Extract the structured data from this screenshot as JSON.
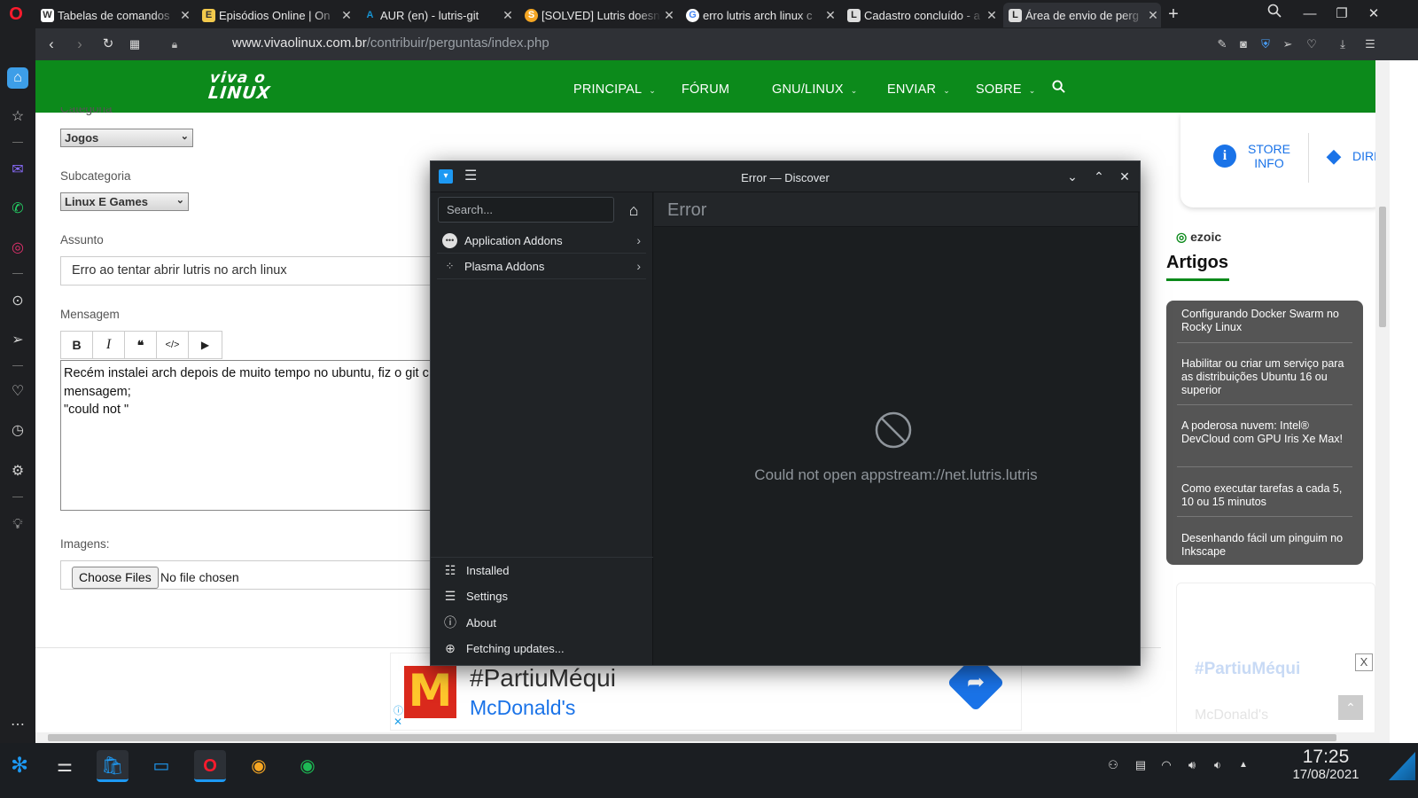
{
  "browser": {
    "tabs": [
      {
        "title": "Tabelas de comandos",
        "favicon": "W"
      },
      {
        "title": "Episódios Online | On",
        "favicon": "E"
      },
      {
        "title": "AUR (en) - lutris-git",
        "favicon": "A"
      },
      {
        "title": "[SOLVED] Lutris doesn",
        "favicon": "S"
      },
      {
        "title": "erro lutris arch linux c",
        "favicon": "G"
      },
      {
        "title": "Cadastro concluído - a",
        "favicon": "L"
      },
      {
        "title": "Área de envio de perg",
        "favicon": "L"
      }
    ],
    "url_host": "www.vivaolinux.com.br",
    "url_path": "/contribuir/perguntas/index.php"
  },
  "site": {
    "logo_line1": "viva o",
    "logo_line2": "LINUX",
    "nav": [
      {
        "label": "PRINCIPAL",
        "dropdown": true
      },
      {
        "label": "FÓRUM",
        "dropdown": false
      },
      {
        "label": "GNU/LINUX",
        "dropdown": true
      },
      {
        "label": "ENVIAR",
        "dropdown": true
      },
      {
        "label": "SOBRE",
        "dropdown": true
      }
    ]
  },
  "form": {
    "categoria_label": "Categoria",
    "categoria_value": "Jogos",
    "subcategoria_label": "Subcategoria",
    "subcategoria_value": "Linux E Games",
    "assunto_label": "Assunto",
    "assunto_value": "Erro ao tentar abrir lutris no arch linux",
    "mensagem_label": "Mensagem",
    "editor_buttons": [
      "B",
      "I",
      "❝",
      "</>",
      "▶"
    ],
    "mensagem_lines": [
      "Recém instalei arch depois de muito tempo no ubuntu, fiz o git c",
      "mensagem;",
      "\"could not \""
    ],
    "imagens_label": "Imagens:",
    "choose_files": "Choose Files",
    "no_file": "No file chosen"
  },
  "sidebar_right": {
    "store_info": "STORE\nINFO",
    "directions": "DIREC",
    "ezoic": "ezoic",
    "artigos_title": "Artigos",
    "artigos": [
      "Configurando Docker Swarm no Rocky Linux",
      "Habilitar ou criar um serviço para as distribuições Ubuntu 16 ou superior",
      "A poderosa nuvem: Intel® DevCloud com GPU Iris Xe Max!",
      "Como executar tarefas a cada 5, 10 ou 15 minutos",
      "Desenhando fácil um pinguim no Inkscape"
    ]
  },
  "ad": {
    "headline": "#PartiuMéqui",
    "brand": "McDonald's",
    "ghost_headline": "#PartiuMéqui",
    "ghost_brand": "McDonald's",
    "close": "X"
  },
  "discover": {
    "window_title": "Error — Discover",
    "search_placeholder": "Search...",
    "categories": [
      "Application Addons",
      "Plasma Addons"
    ],
    "bottom_items": [
      "Installed",
      "Settings",
      "About",
      "Fetching updates..."
    ],
    "page_title": "Error",
    "error_message": "Could not open appstream://net.lutris.lutris"
  },
  "taskbar": {
    "time": "17:25",
    "date": "17/08/2021"
  },
  "colors": {
    "vol_green": "#0c8a1b",
    "opera_red": "#ff1b2d",
    "discover_bg": "#1b1e20"
  }
}
